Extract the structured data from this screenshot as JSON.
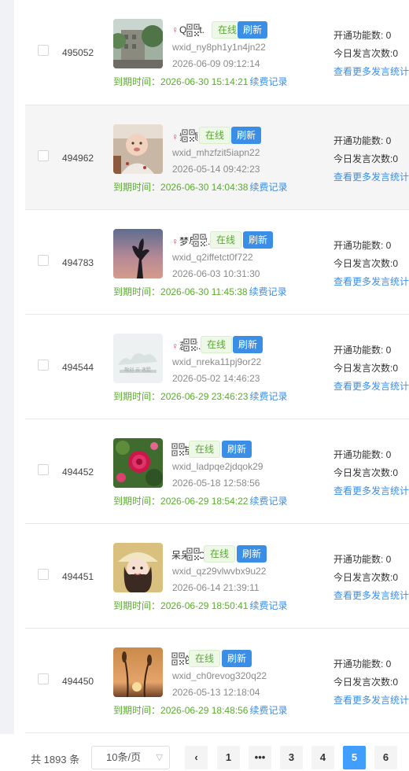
{
  "rows": [
    {
      "id": "495052",
      "nick": "Quiet.",
      "female": true,
      "status": "在线",
      "refresh": "刷新",
      "wxid": "wxid_ny8ph1y1n4jn22",
      "created": "2026-06-09 09:12:14",
      "expire_label": "到期时间：",
      "expire": "2026-06-30 15:14:21",
      "renew": "续费记录",
      "func_count": "开通功能数: 0",
      "msg_count": "今日发言次数:0",
      "more": "查看更多发言统计"
    },
    {
      "id": "494962",
      "nick": "紫颜",
      "female": true,
      "status": "在线",
      "refresh": "刷新",
      "wxid": "wxid_mhzfzit5iapn22",
      "created": "2026-05-14 09:42:23",
      "expire_label": "到期时间：",
      "expire": "2026-06-30 14:04:38",
      "renew": "续费记录",
      "func_count": "开通功能数: 0",
      "msg_count": "今日发言次数:0",
      "more": "查看更多发言统计"
    },
    {
      "id": "494783",
      "nick": "梦尽破.",
      "female": true,
      "status": "在线",
      "refresh": "刷新",
      "wxid": "wxid_q2iffetct0f722",
      "created": "2026-06-03 10:31:30",
      "expire_label": "到期时间：",
      "expire": "2026-06-30 11:45:38",
      "renew": "续费记录",
      "func_count": "开通功能数: 0",
      "msg_count": "今日发言次数:0",
      "more": "查看更多发言统计"
    },
    {
      "id": "494544",
      "nick": "蕊蕊.",
      "female": true,
      "status": "在线",
      "refresh": "刷新",
      "wxid": "wxid_nreka11pj9or22",
      "created": "2026-05-02 14:46:23",
      "expire_label": "到期时间：",
      "expire": "2026-06-29 23:46:23",
      "renew": "续费记录",
      "func_count": "开通功能数: 0",
      "msg_count": "今日发言次数:0",
      "more": "查看更多发言统计"
    },
    {
      "id": "494452",
      "nick": "庆店",
      "female": false,
      "status": "在线",
      "refresh": "刷新",
      "wxid": "wxid_ladpqe2jdqok29",
      "created": "2026-05-18 12:58:56",
      "expire_label": "到期时间：",
      "expire": "2026-06-29 18:54:22",
      "renew": "续费记录",
      "func_count": "开通功能数: 0",
      "msg_count": "今日发言次数:0",
      "more": "查看更多发言统计"
    },
    {
      "id": "494451",
      "nick": "呆呆o.O",
      "female": false,
      "status": "在线",
      "refresh": "刷新",
      "wxid": "wxid_qz29vlwvbx9u22",
      "created": "2026-06-14 21:39:11",
      "expire_label": "到期时间：",
      "expire": "2026-06-29 18:50:41",
      "renew": "续费记录",
      "func_count": "开通功能数: 0",
      "msg_count": "今日发言次数:0",
      "more": "查看更多发言统计"
    },
    {
      "id": "494450",
      "nick": "芳纶",
      "female": false,
      "status": "在线",
      "refresh": "刷新",
      "wxid": "wxid_ch0revog320q22",
      "created": "2026-05-13 12:18:04",
      "expire_label": "到期时间：",
      "expire": "2026-06-29 18:48:56",
      "renew": "续费记录",
      "func_count": "开通功能数: 0",
      "msg_count": "今日发言次数:0",
      "more": "查看更多发言统计"
    }
  ],
  "avatar_texts": {
    "cloud_logo": "融创 云·逸墅"
  },
  "pagination": {
    "total": "共 1893 条",
    "page_size": "10条/页",
    "prev": "‹",
    "pages": [
      "1",
      "•••",
      "3",
      "4",
      "5",
      "6"
    ],
    "current": "5"
  },
  "colors": {
    "online": "#5aa637",
    "refresh_bg": "#3a8ee6",
    "expire": "#5aac2e",
    "link": "#3a8ee6",
    "page_active": "#409eff"
  }
}
